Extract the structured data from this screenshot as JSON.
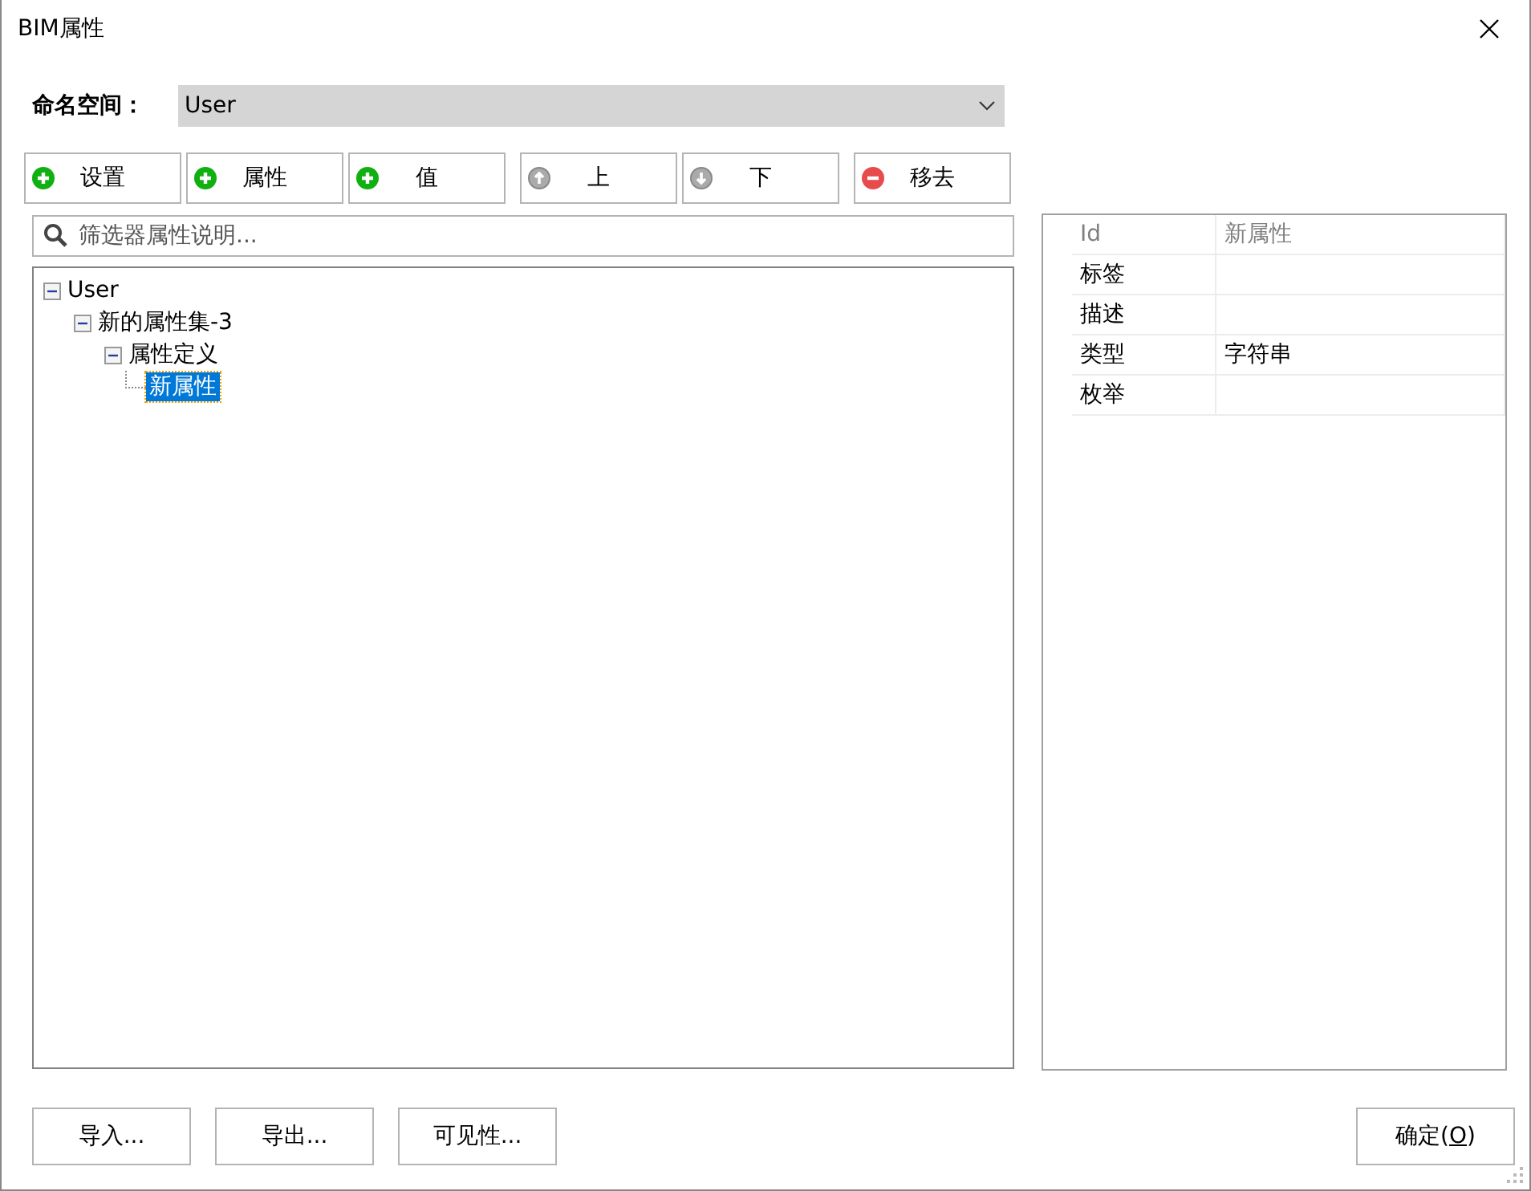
{
  "window": {
    "title": "BIM属性"
  },
  "namespace": {
    "label": "命名空间：",
    "value": "User"
  },
  "toolbar": [
    {
      "label": "设置",
      "kind": "add"
    },
    {
      "label": "属性",
      "kind": "add"
    },
    {
      "label": "值",
      "kind": "add"
    },
    {
      "label": "上",
      "kind": "up"
    },
    {
      "label": "下",
      "kind": "down"
    },
    {
      "label": "移去",
      "kind": "remove"
    }
  ],
  "search": {
    "placeholder": "筛选器属性说明..."
  },
  "tree": [
    {
      "label": "User",
      "expanded": true,
      "selected": false,
      "children": [
        {
          "label": "新的属性集-3",
          "expanded": true,
          "selected": false,
          "children": [
            {
              "label": "属性定义",
              "expanded": true,
              "selected": false,
              "children": [
                {
                  "label": "新属性",
                  "selected": true
                }
              ]
            }
          ]
        }
      ]
    }
  ],
  "properties": [
    {
      "name": "Id",
      "value": "新属性",
      "readonly": true
    },
    {
      "name": "标签",
      "readonly": false
    },
    {
      "name": "描述",
      "readonly": false
    },
    {
      "name": "类型",
      "value": "字符串",
      "readonly": false
    },
    {
      "name": "枚举",
      "readonly": false
    }
  ],
  "footer_buttons": [
    {
      "label": "导入..."
    },
    {
      "label": "导出..."
    },
    {
      "label": "可见性..."
    }
  ],
  "ok_button": {
    "parts": [
      "确定(",
      "O",
      ")"
    ]
  }
}
